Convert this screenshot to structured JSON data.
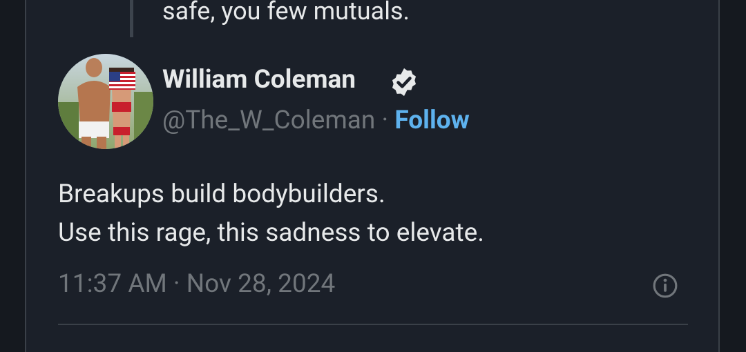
{
  "previous_tweet": {
    "text_fragment": "safe, you few mutuals."
  },
  "tweet": {
    "author": {
      "name": "William Coleman",
      "handle": "@The_W_Coleman",
      "separator": "·",
      "follow_label": "Follow",
      "verified": true,
      "avatar_icon": "profile-photo"
    },
    "body_lines": [
      "Breakups build bodybuilders.",
      "Use this rage, this sadness to elevate."
    ],
    "timestamp": "11:37 AM · Nov 28, 2024",
    "info_icon": "info-icon"
  },
  "colors": {
    "background": "#1b2029",
    "text_primary": "#e7e9ea",
    "text_secondary": "#71767b",
    "accent": "#5eb2ee",
    "divider": "#3a4048"
  }
}
